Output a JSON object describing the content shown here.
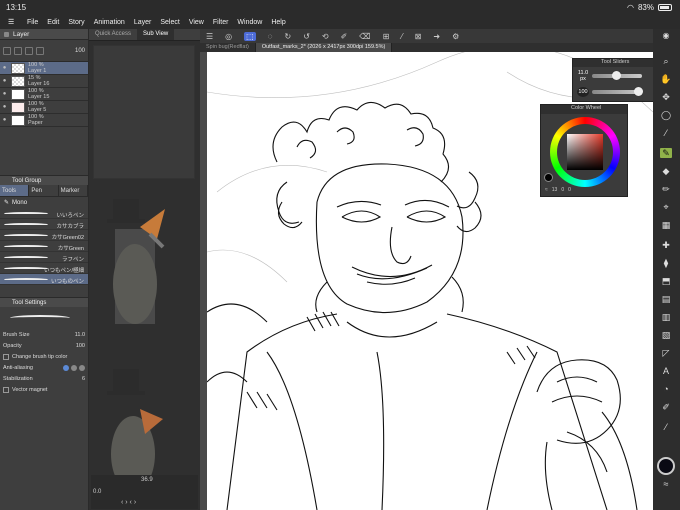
{
  "status": {
    "time": "13:15",
    "battery": "83%"
  },
  "menu": [
    "File",
    "Edit",
    "Story",
    "Animation",
    "Layer",
    "Select",
    "View",
    "Filter",
    "Window",
    "Help"
  ],
  "layer_panel": {
    "title": "Layer",
    "opacity_value": "100",
    "layers": [
      {
        "pct": "100 %",
        "blend": "Normal",
        "name": "Layer 1",
        "selected": true
      },
      {
        "pct": "15 %",
        "blend": "Normal",
        "name": "Layer 16",
        "selected": false
      },
      {
        "pct": "100 %",
        "blend": "Normal",
        "name": "Layer 15",
        "selected": false
      },
      {
        "pct": "100 %",
        "blend": "Normal",
        "name": "Layer 5",
        "selected": false
      },
      {
        "pct": "100 %",
        "blend": "Normal",
        "name": "Paper",
        "selected": false
      }
    ]
  },
  "tool_group": {
    "title": "Tool Group",
    "tabs": [
      "Tools",
      "Pen",
      "Marker"
    ],
    "subtool": "Mono",
    "brushes": [
      "いいろペン",
      "カサカブラ",
      "カサGreen02",
      "カサGreen",
      "ラフペン",
      "いつもペン/極細",
      "いつものペン"
    ]
  },
  "tool_settings": {
    "title": "Tool Settings",
    "brush_size_label": "Brush Size",
    "brush_size_value": "11.0",
    "opacity_label": "Opacity",
    "opacity_value": "100",
    "change_tip_label": "Change brush tip color",
    "antialias_label": "Anti-aliasing",
    "stabilization_label": "Stabilization",
    "stabilization_value": "6",
    "vector_label": "Vector magnet"
  },
  "subview": {
    "tabs": [
      "Quick Access",
      "Sub View"
    ],
    "zoom": "36.9",
    "rotate": "0.0"
  },
  "doc_tabs": [
    "Spin bug(Redflat)",
    "Outfast_marks_2* (2026 x 2417px 300dpi 159.5%)"
  ],
  "tool_sliders": {
    "title": "Tool Sliders",
    "size": "11.0",
    "size_unit": "px",
    "opacity": "100"
  },
  "color_wheel": {
    "title": "Color Wheel",
    "h": "13",
    "s": "0",
    "v": "0"
  },
  "colors": {
    "accent": "#5c6b88",
    "active_tool": "#90b24a",
    "selected_cmd": "#4d6bd6"
  }
}
